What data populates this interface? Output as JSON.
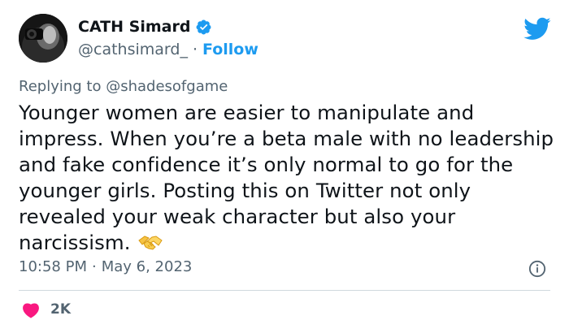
{
  "author": {
    "display_name": "CATH Simard",
    "handle": "@cathsimard_",
    "separator": "·",
    "follow_label": "Follow"
  },
  "reply": {
    "prefix": "Replying to",
    "mention": "@shadesofgame"
  },
  "tweet": {
    "text": "Younger women are easier to manipulate and impress. When you’re a beta male with no leadership and fake confidence it’s only normal to go for the younger girls. Posting this on Twitter not only revealed your weak character but also your narcissism."
  },
  "meta": {
    "time": "10:58 PM",
    "separator": "·",
    "date": "May 6, 2023"
  },
  "engagement": {
    "likes": "2K"
  },
  "icons": {
    "verified": "verified-badge-icon",
    "bird": "twitter-bird-icon",
    "info": "info-icon",
    "heart": "heart-icon",
    "emoji": "handshake-emoji"
  },
  "colors": {
    "accent": "#1d9bf0",
    "secondary_text": "#536471",
    "heart": "#f91880",
    "divider": "#cfd9de"
  }
}
